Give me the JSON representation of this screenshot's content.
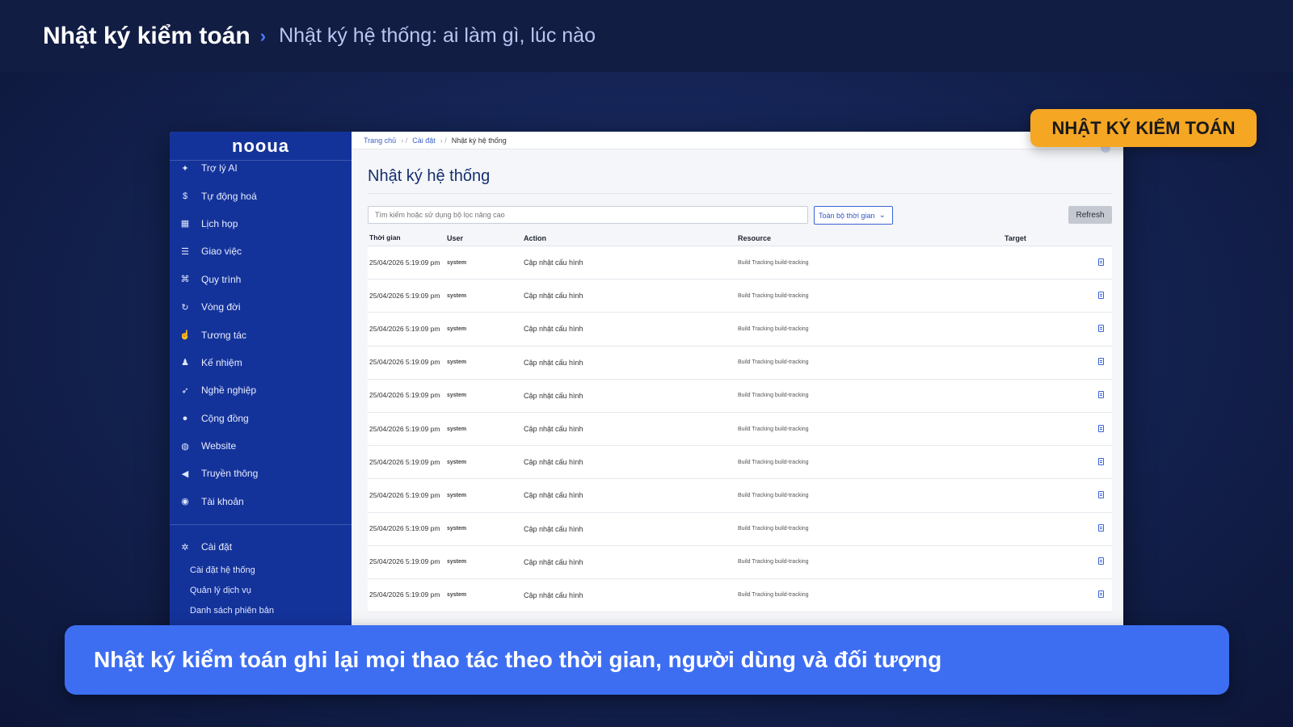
{
  "header": {
    "title": "Nhật ký kiểm toán",
    "separator": "›",
    "subtitle": "Nhật ký hệ thống: ai làm gì, lúc nào"
  },
  "badge": "NHẬT KÝ KIỂM TOÁN",
  "caption": "Nhật ký kiểm toán ghi lại mọi thao tác theo thời gian, người dùng và đối tượng",
  "app": {
    "logo": "nooua",
    "breadcrumb": [
      "Trang chủ",
      "Cài đặt",
      "Nhật ký hệ thống"
    ],
    "sidebar": {
      "items": [
        {
          "label": "Trợ lý AI",
          "icon": "sparkle-icon",
          "glyph": "✦"
        },
        {
          "label": "Tự động hoá",
          "icon": "dollar-icon",
          "glyph": "$"
        },
        {
          "label": "Lịch họp",
          "icon": "calendar-icon",
          "glyph": "▦"
        },
        {
          "label": "Giao việc",
          "icon": "list-icon",
          "glyph": "☰"
        },
        {
          "label": "Quy trình",
          "icon": "workflow-icon",
          "glyph": "⌘"
        },
        {
          "label": "Vòng đời",
          "icon": "refresh-icon",
          "glyph": "↻"
        },
        {
          "label": "Tương tác",
          "icon": "thumbs-up-icon",
          "glyph": "☝"
        },
        {
          "label": "Kế nhiệm",
          "icon": "users-icon",
          "glyph": "♟"
        },
        {
          "label": "Nghề nghiệp",
          "icon": "rocket-icon",
          "glyph": "➶"
        },
        {
          "label": "Cộng đồng",
          "icon": "chat-icon",
          "glyph": "●"
        },
        {
          "label": "Website",
          "icon": "globe-icon",
          "glyph": "◍"
        },
        {
          "label": "Truyền thông",
          "icon": "megaphone-icon",
          "glyph": "◀"
        },
        {
          "label": "Tài khoản",
          "icon": "account-icon",
          "glyph": "◉"
        }
      ],
      "settings": {
        "label": "Cài đặt",
        "icon": "gear-icon",
        "glyph": "✲"
      },
      "sub_items": [
        "Cài đặt hệ thống",
        "Quản lý dịch vụ",
        "Danh sách phiên bản"
      ]
    },
    "page_title": "Nhật ký hệ thống",
    "search_placeholder": "Tìm kiếm hoặc sử dụng bộ lọc nâng cao",
    "time_filter": "Toàn bộ thời gian",
    "refresh_label": "Refresh",
    "table": {
      "headers": [
        "Thời gian",
        "User",
        "Action",
        "Resource",
        "Target"
      ],
      "rows": [
        {
          "time": "25/04/2026 5:19:09 pm",
          "user": "system",
          "action": "Cập nhật cấu hình",
          "resource": "Build Tracking build-tracking"
        },
        {
          "time": "25/04/2026 5:19:09 pm",
          "user": "system",
          "action": "Cập nhật cấu hình",
          "resource": "Build Tracking build-tracking"
        },
        {
          "time": "25/04/2026 5:19:09 pm",
          "user": "system",
          "action": "Cập nhật cấu hình",
          "resource": "Build Tracking build-tracking"
        },
        {
          "time": "25/04/2026 5:19:09 pm",
          "user": "system",
          "action": "Cập nhật cấu hình",
          "resource": "Build Tracking build-tracking"
        },
        {
          "time": "25/04/2026 5:19:09 pm",
          "user": "system",
          "action": "Cập nhật cấu hình",
          "resource": "Build Tracking build-tracking"
        },
        {
          "time": "25/04/2026 5:19:09 pm",
          "user": "system",
          "action": "Cập nhật cấu hình",
          "resource": "Build Tracking build-tracking"
        },
        {
          "time": "25/04/2026 5:19:09 pm",
          "user": "system",
          "action": "Cập nhật cấu hình",
          "resource": "Build Tracking build-tracking"
        },
        {
          "time": "25/04/2026 5:19:09 pm",
          "user": "system",
          "action": "Cập nhật cấu hình",
          "resource": "Build Tracking build-tracking"
        },
        {
          "time": "25/04/2026 5:19:09 pm",
          "user": "system",
          "action": "Cập nhật cấu hình",
          "resource": "Build Tracking build-tracking"
        },
        {
          "time": "25/04/2026 5:19:09 pm",
          "user": "system",
          "action": "Cập nhật cấu hình",
          "resource": "Build Tracking build-tracking"
        },
        {
          "time": "25/04/2026 5:19:09 pm",
          "user": "system",
          "action": "Cập nhật cấu hình",
          "resource": "Build Tracking build-tracking"
        }
      ]
    }
  },
  "colors": {
    "sidebar": "#14339a",
    "badge": "#f5a623",
    "caption": "#3d6ef2",
    "accent": "#3b63d8"
  }
}
